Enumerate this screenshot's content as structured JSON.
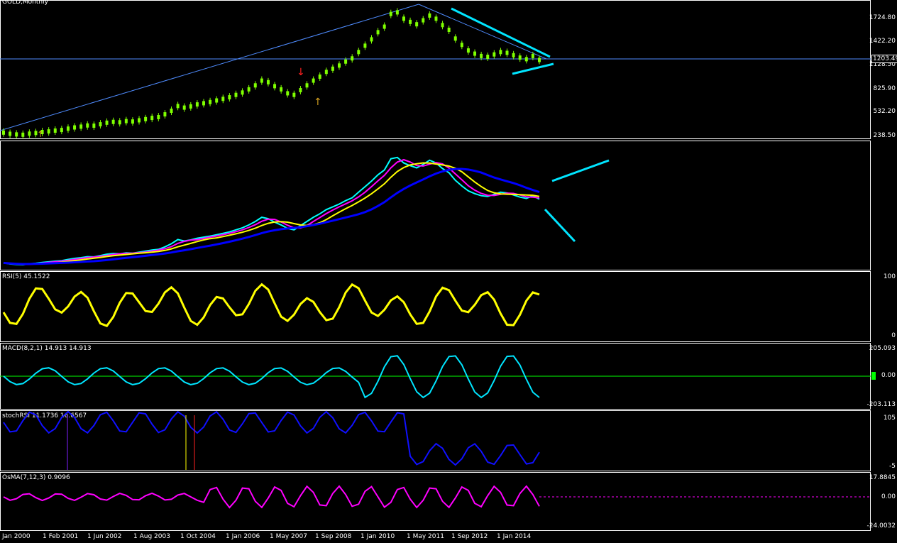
{
  "chart_data": {
    "type": "line",
    "title": "GOLD,Monthly",
    "symbol": "GOLD",
    "timeframe": "Monthly",
    "x_axis": [
      "Jan 2000",
      "1 Feb 2001",
      "1 Jun 2002",
      "1 Aug 2003",
      "1 Oct 2004",
      "1 Jan 2006",
      "1 May 2007",
      "1 Sep 2008",
      "1 Jan 2010",
      "1 May 2011",
      "1 Sep 2012",
      "1 Jan 2014"
    ],
    "panes": [
      {
        "name": "price",
        "type": "candlestick",
        "yticks": [
          "1724.80",
          "1422.20",
          "1203.49",
          "1128.50",
          "825.90",
          "532.20",
          "238.50"
        ],
        "ylim": [
          238.5,
          1920
        ],
        "last_price": "1203.49",
        "series": [
          {
            "name": "GOLD",
            "values": [
              285,
              270,
              262,
              258,
              272,
              280,
              292,
              300,
              310,
              318,
              335,
              350,
              360,
              375,
              372,
              390,
              410,
              420,
              415,
              430,
              425,
              440,
              455,
              470,
              480,
              515,
              560,
              620,
              600,
              615,
              640,
              655,
              670,
              690,
              710,
              730,
              760,
              790,
              830,
              880,
              940,
              920,
              870,
              830,
              780,
              760,
              820,
              880,
              940,
              990,
              1050,
              1090,
              1130,
              1180,
              1220,
              1300,
              1380,
              1460,
              1550,
              1620,
              1780,
              1800,
              1720,
              1680,
              1650,
              1700,
              1760,
              1720,
              1640,
              1580,
              1470,
              1390,
              1320,
              1280,
              1250,
              1240,
              1270,
              1300,
              1290,
              1260,
              1230,
              1210,
              1250,
              1200
            ]
          }
        ],
        "annotations": [
          "downtrend line from 2011 high",
          "support arrow",
          "up arrow",
          "down arrow"
        ]
      },
      {
        "name": "moving-averages",
        "type": "line",
        "series": [
          {
            "name": "fast",
            "color": "#00ffff"
          },
          {
            "name": "mid",
            "color": "#ff00ff"
          },
          {
            "name": "slow",
            "color": "#ffff00"
          },
          {
            "name": "long",
            "color": "#0000ff"
          }
        ]
      },
      {
        "name": "rsi",
        "label": "RSI(5) 45.1522",
        "yticks": [
          "100",
          "0"
        ],
        "ylim": [
          0,
          100
        ]
      },
      {
        "name": "macd",
        "label": "MACD(8,2,1) 14.913 14.913",
        "yticks": [
          "205.093",
          "0.00",
          "-203.113"
        ],
        "ylim": [
          -203.113,
          205.093
        ]
      },
      {
        "name": "stochrsi",
        "label": "stochRSI 11.1736 16.6567",
        "yticks": [
          "105",
          "-5"
        ],
        "ylim": [
          -5,
          105
        ]
      },
      {
        "name": "osma",
        "label": "OsMA(7,12,3) 0.9096",
        "yticks": [
          "17.8845",
          "0.00",
          "-24.0032"
        ],
        "ylim": [
          -24.0032,
          17.8845
        ]
      }
    ],
    "colors": {
      "background": "#000000",
      "candles": "#7fff00",
      "trendline": "#4f8cff",
      "annotation": "#00e5ff",
      "rsi": "#ffff00",
      "stoch_blue": "#1010ff"
    }
  }
}
